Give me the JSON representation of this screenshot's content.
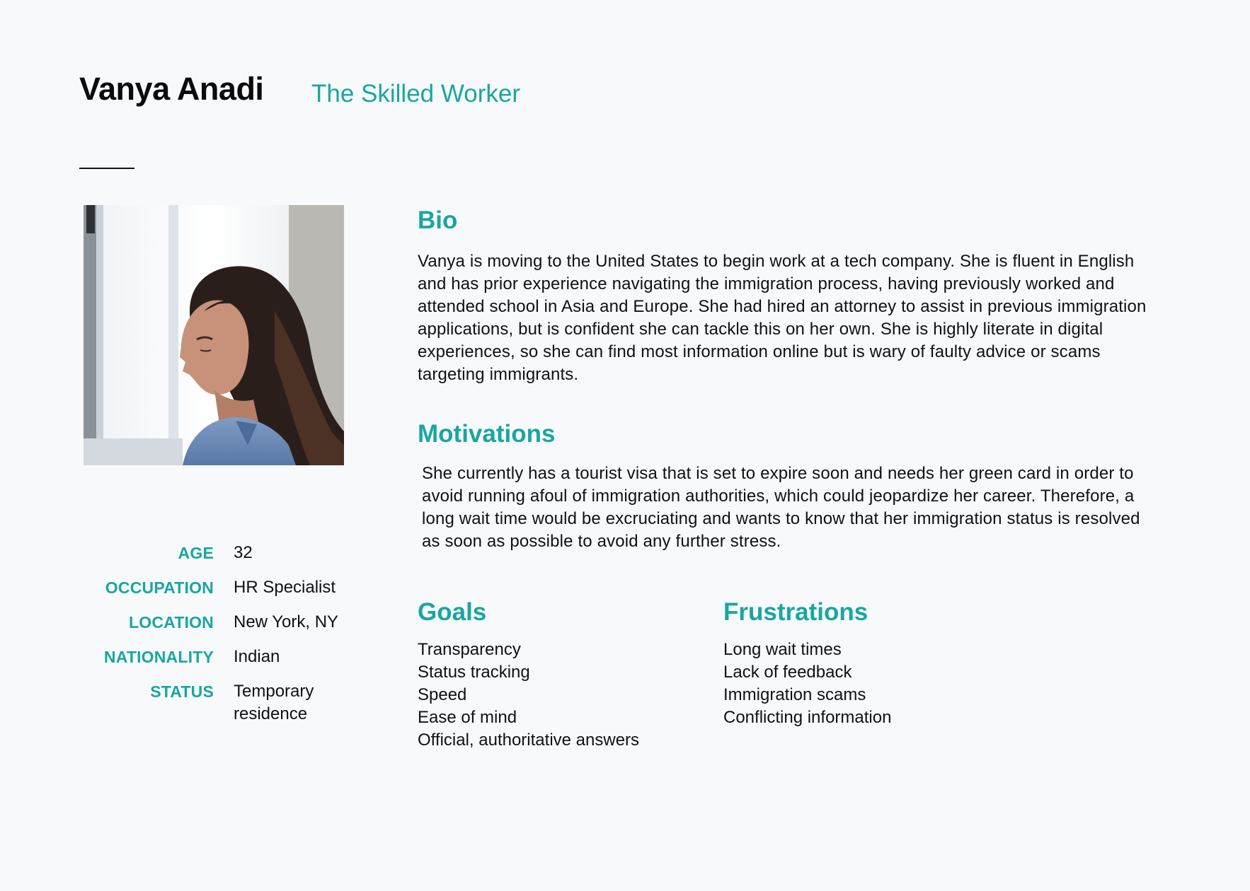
{
  "header": {
    "name": "Vanya Anadi",
    "tagline": "The Skilled Worker"
  },
  "photo": {
    "icon": "persona-photo-woman-by-window"
  },
  "facts": [
    {
      "label": "AGE",
      "value": "32"
    },
    {
      "label": "OCCUPATION",
      "value": "HR Specialist"
    },
    {
      "label": "LOCATION",
      "value": "New York, NY"
    },
    {
      "label": "NATIONALITY",
      "value": "Indian"
    },
    {
      "label": "STATUS",
      "value": "Temporary residence"
    }
  ],
  "bio": {
    "title": "Bio",
    "text": "Vanya is moving to the United States to begin work at a tech company. She is fluent in English and has prior experience navigating the immigration process, having previously worked and attended school in Asia and Europe. She had hired an attorney to assist in previous immigration applications, but is confident she can tackle this on her own. She is highly literate in digital experiences, so she can find most information online but is wary of faulty advice or scams targeting immigrants."
  },
  "motivations": {
    "title": "Motivations",
    "text": "She currently has a tourist visa that is set to expire soon and needs her green card in order to avoid running afoul of immigration authorities, which could jeopardize her career. Therefore, a long wait time would be excruciating and wants to know that her immigration status is resolved as soon as possible to avoid any further stress."
  },
  "goals": {
    "title": "Goals",
    "items": [
      "Transparency",
      "Status tracking",
      "Speed",
      "Ease of mind",
      "Official, authoritative answers"
    ]
  },
  "frustrations": {
    "title": "Frustrations",
    "items": [
      "Long wait times",
      "Lack of feedback",
      "Immigration scams",
      "Conflicting information"
    ]
  },
  "colors": {
    "accent": "#1aa6a0",
    "background": "#f8f9fb",
    "text": "#111111"
  }
}
